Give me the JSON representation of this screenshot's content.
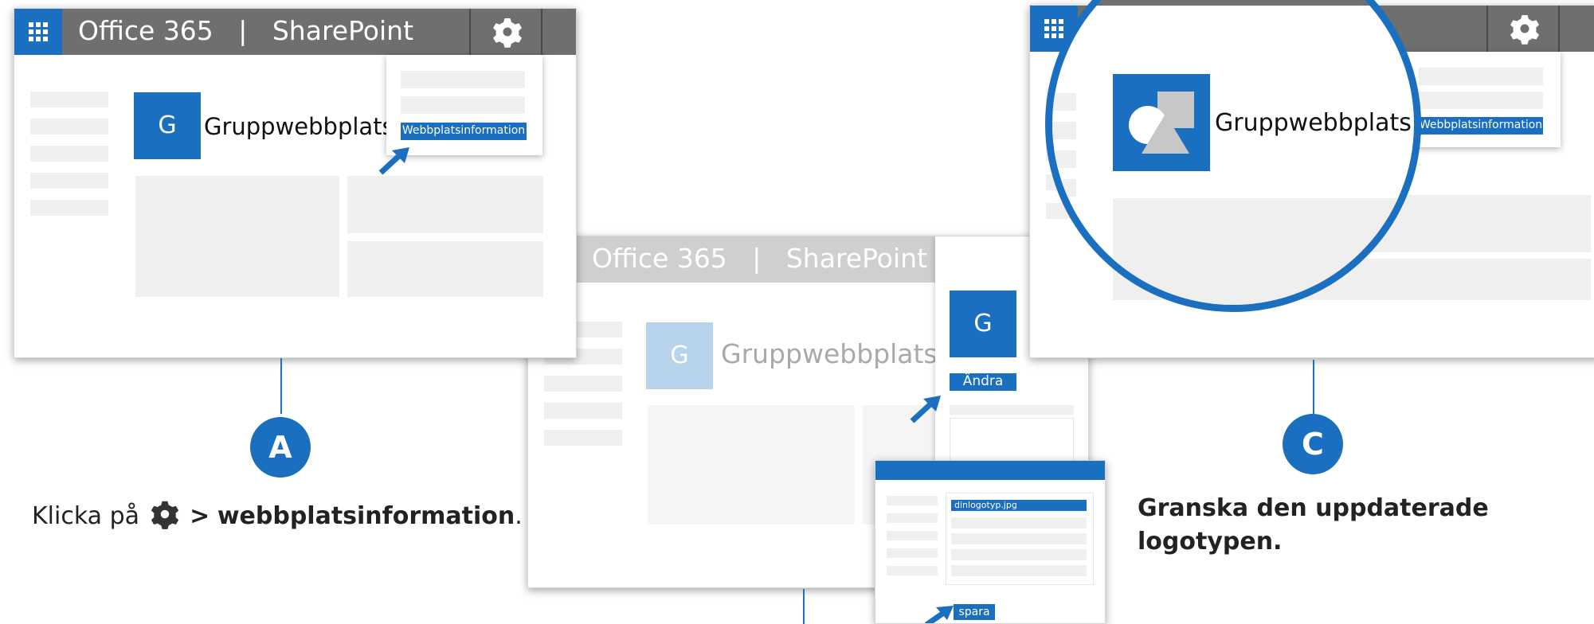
{
  "colors": {
    "accent": "#1a6fc0",
    "suitebar": "#6f6f6f",
    "faded_suitebar": "#cfcfcf",
    "placeholder": "#efefef"
  },
  "panel_a": {
    "suite_title": "Office 365   |   SharePoint",
    "site_initial": "G",
    "site_name": "Gruppwebbplats",
    "menu_item": "Webbplatsinformation",
    "step_label": "A",
    "caption_prefix": "Klicka på",
    "caption_separator": ">",
    "caption_bold": "webbplatsinformation",
    "caption_suffix": "."
  },
  "panel_b": {
    "suite_title": "Office 365   |   SharePoint",
    "site_initial": "G",
    "site_name": "Gruppwebbplats",
    "side_initial": "G",
    "change_button": "Ändra",
    "file_name": "dinlogotyp.jpg",
    "save_button": "spara"
  },
  "panel_c": {
    "site_name": "Gruppwebbplats",
    "menu_item": "Webbplatsinformation",
    "step_label": "C",
    "caption": "Granska den uppdaterade logotypen."
  },
  "icons": [
    "app-launcher-icon",
    "gear-icon",
    "pointer-arrow-icon",
    "shapes-logo-icon"
  ]
}
